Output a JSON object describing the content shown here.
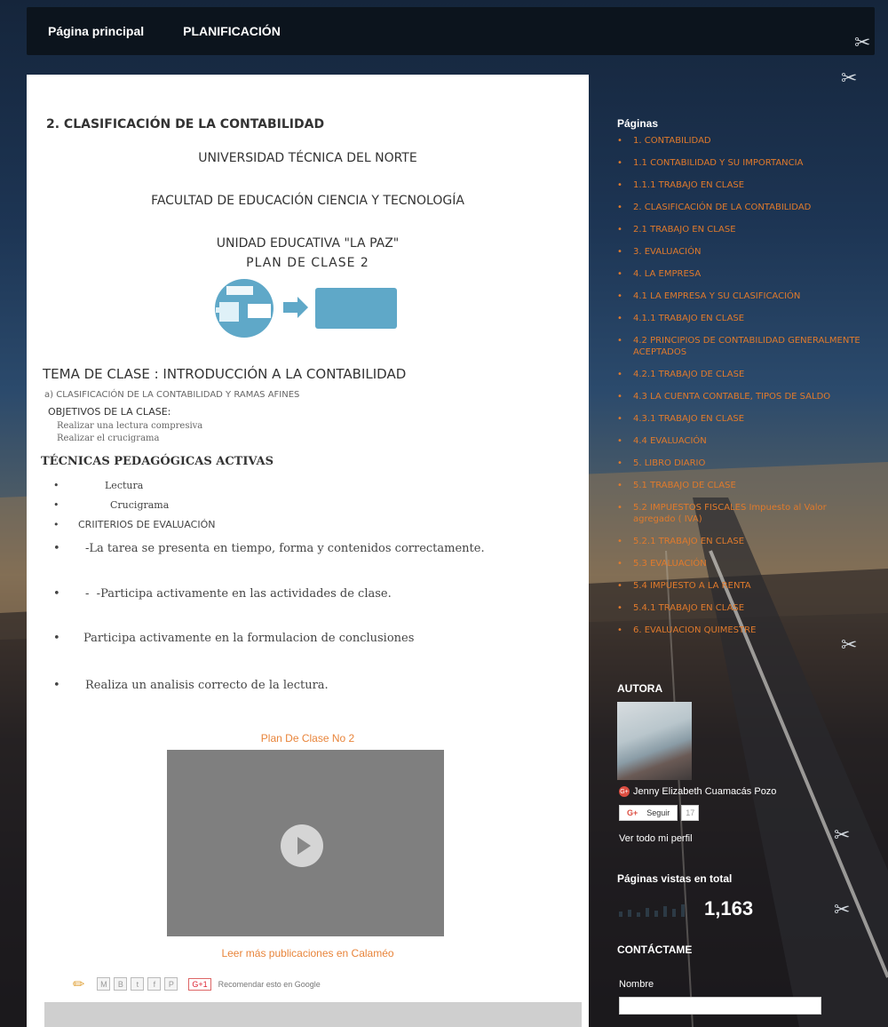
{
  "nav": {
    "home": "Página principal",
    "planificacion": "PLANIFICACIÓN"
  },
  "post": {
    "title": "2. CLASIFICACIÓN DE LA CONTABILIDAD",
    "university": "UNIVERSIDAD TÉCNICA DEL NORTE",
    "faculty": "FACULTAD DE EDUCACIÓN CIENCIA Y TECNOLOGÍA",
    "school": "UNIDAD EDUCATIVA \"LA PAZ\"",
    "plan": "PLAN DE CLASE 2",
    "tema": "TEMA DE CLASE : INTRODUCCIÓN A LA CONTABILIDAD",
    "subtema": "a) CLASIFICACIÓN DE LA CONTABILIDAD  Y RAMAS AFINES",
    "objetivos_head": "OBJETIVOS DE LA CLASE:",
    "objetivos": [
      "Realizar una lectura compresiva",
      "Realizar el crucigrama"
    ],
    "tecnicas_head": "TÉCNICAS PEDAGÓGICAS ACTIVAS",
    "tecnicas": [
      "Lectura",
      "Crucigrama"
    ],
    "criterios_head": "CRIITERIOS DE EVALUACIÓN",
    "criterios": [
      "-La tarea se presenta en tiempo, forma y contenidos correctamente.",
      "-Participa activamente en las actividades de clase.",
      "Participa activamente en la formulacion de conclusiones",
      "Realiza un analisis correcto de la lectura."
    ],
    "calameo_title": "Plan De Clase No 2",
    "calameo_more": "Leer más publicaciones en Calaméo",
    "share_icons": [
      "M",
      "B",
      "t",
      "f",
      "P"
    ],
    "gplus": "G+1",
    "recommend": "Recomendar esto en Google"
  },
  "sidebar": {
    "pages_head": "Páginas",
    "pages": [
      "1. CONTABILIDAD",
      "1.1 CONTABILIDAD Y SU IMPORTANCIA",
      "1.1.1 TRABAJO EN CLASE",
      "2. CLASIFICACIÓN DE LA CONTABILIDAD",
      "2.1 TRABAJO EN CLASE",
      "3. EVALUACIÓN",
      "4. LA EMPRESA",
      "4.1 LA EMPRESA Y SU CLASIFICACIÓN",
      "4.1.1 TRABAJO EN CLASE",
      "4.2 PRINCIPIOS DE CONTABILIDAD GENERALMENTE ACEPTADOS",
      "4.2.1 TRABAJO DE CLASE",
      "4.3 LA CUENTA CONTABLE, TIPOS DE SALDO",
      "4.3.1 TRABAJO EN CLASE",
      "4.4 EVALUACIÓN",
      "5. LIBRO DIARIO",
      "5.1 TRABAJO DE CLASE",
      "5.2 IMPUESTOS FISCALES Impuesto al Valor agregado ( IVA)",
      "5.2.1 TRABAJO EN CLASE",
      "5.3 EVALUACIÓN",
      "5.4 IMPUESTO A LA RENTA",
      "5.4.1 TRABAJO EN CLASE",
      "6. EVALUACION QUIMESTRE"
    ],
    "author_head": "AUTORA",
    "author_name": "Jenny Elizabeth Cuamacás Pozo",
    "follow_label": "Seguir",
    "follow_g": "G+",
    "follow_count": "17",
    "profile_link": "Ver todo mi perfil",
    "views_head": "Páginas vistas en total",
    "views_count": "1,163",
    "contact_head": "CONTÁCTAME",
    "name_label": "Nombre"
  },
  "colors": {
    "link_orange": "#e07a2c",
    "nav_bg": "#0c141d"
  }
}
